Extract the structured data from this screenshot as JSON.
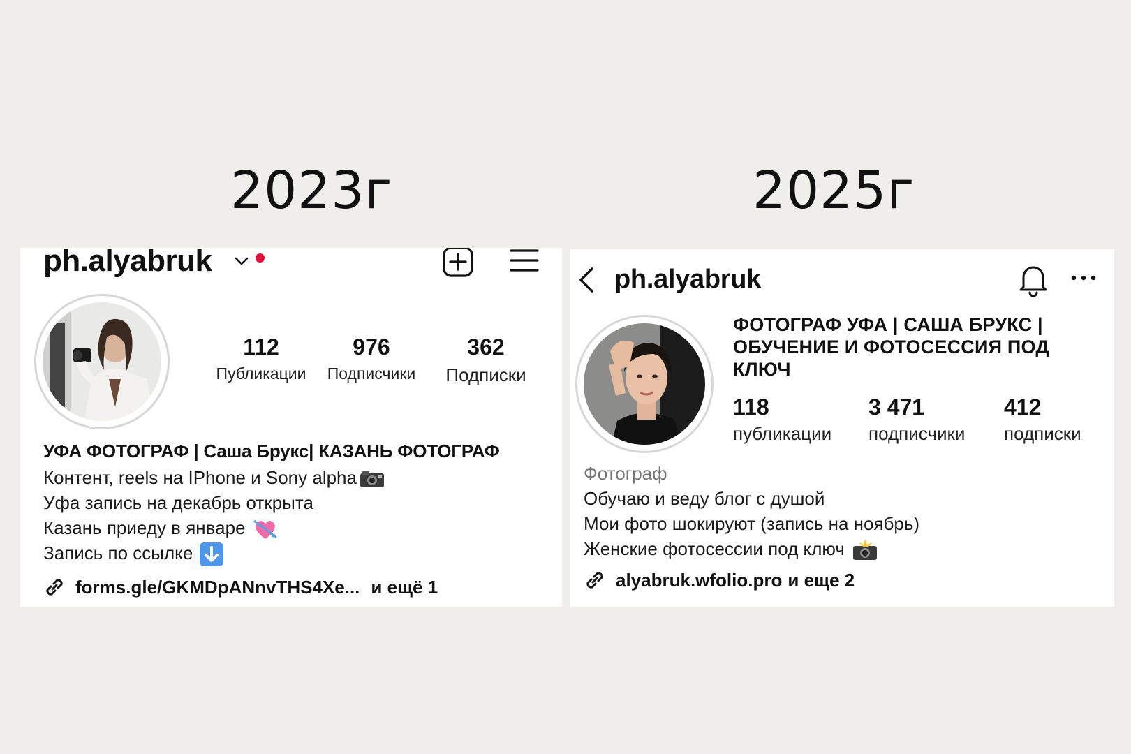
{
  "years": {
    "left": "2023г",
    "right": "2025г"
  },
  "old_profile": {
    "username": "ph.alyabruk",
    "stats": [
      {
        "value": "112",
        "label": "Публикации"
      },
      {
        "value": "976",
        "label": "Подписчики"
      },
      {
        "value": "362",
        "label": "Подписки"
      }
    ],
    "bio_name": "УФА ФОТОГРАФ | Саша Брукс| КАЗАНЬ ФОТОГРАФ",
    "bio_lines": [
      "Контент, reels на IPhone и Sony alpha",
      "Уфа запись на декабрь открыта",
      "Казань приеду в январе",
      "Запись по ссылке"
    ],
    "link": "forms.gle/GKMDpANnvTHS4Xe...",
    "link_more": "и ещё 1",
    "notification_dot_color": "#e0103a",
    "icons": [
      "chevron-down-icon",
      "create-post-icon",
      "menu-icon",
      "link-icon",
      "camera-emoji",
      "heart-arrow-emoji",
      "down-arrow-emoji"
    ]
  },
  "new_profile": {
    "username": "ph.alyabruk",
    "title_lines": [
      "ФОТОГРАФ УФА | САША БРУКС |",
      "ОБУЧЕНИЕ И ФОТОСЕССИЯ ПОД",
      "КЛЮЧ"
    ],
    "stats": [
      {
        "value": "118",
        "label": "публикации"
      },
      {
        "value": "3 471",
        "label": "подписчики"
      },
      {
        "value": "412",
        "label": "подписки"
      }
    ],
    "category": "Фотограф",
    "bio_lines": [
      "Обучаю и веду блог с душой",
      "Мои фото шокируют (запись на ноябрь)",
      "Женские фотосессии под ключ"
    ],
    "link": "alyabruk.wfolio.pro",
    "link_more": "и еще 2",
    "icons": [
      "back-icon",
      "bell-icon",
      "more-icon",
      "link-icon",
      "camera-flash-emoji"
    ]
  }
}
